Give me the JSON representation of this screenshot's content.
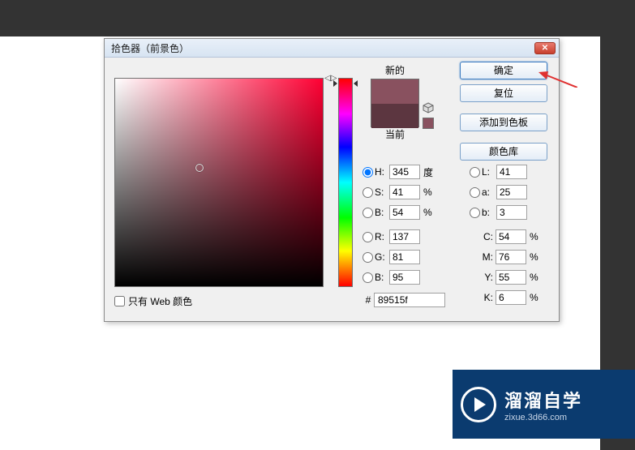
{
  "dialog": {
    "title": "拾色器（前景色）",
    "close_glyph": "✕",
    "new_label": "新的",
    "current_label": "当前",
    "web_only_label": "只有 Web 颜色",
    "hash": "#",
    "hex_value": "89515f",
    "buttons": {
      "ok": "确定",
      "reset": "复位",
      "add_swatch": "添加到色板",
      "libraries": "颜色库"
    },
    "hsb": {
      "h_label": "H:",
      "h_value": "345",
      "h_unit": "度",
      "s_label": "S:",
      "s_value": "41",
      "s_unit": "%",
      "b_label": "B:",
      "b_value": "54",
      "b_unit": "%"
    },
    "rgb": {
      "r_label": "R:",
      "r_value": "137",
      "g_label": "G:",
      "g_value": "81",
      "b_label": "B:",
      "b_value": "95"
    },
    "lab": {
      "l_label": "L:",
      "l_value": "41",
      "a_label": "a:",
      "a_value": "25",
      "b_label": "b:",
      "b_value": "3"
    },
    "cmyk": {
      "c_label": "C:",
      "c_value": "54",
      "c_unit": "%",
      "m_label": "M:",
      "m_value": "76",
      "m_unit": "%",
      "y_label": "Y:",
      "y_value": "55",
      "y_unit": "%",
      "k_label": "K:",
      "k_value": "6",
      "k_unit": "%"
    },
    "colors": {
      "new_hex": "#89515f",
      "current_hex": "#5c3640"
    }
  },
  "brand": {
    "name": "溜溜自学",
    "url": "zixue.3d66.com"
  }
}
